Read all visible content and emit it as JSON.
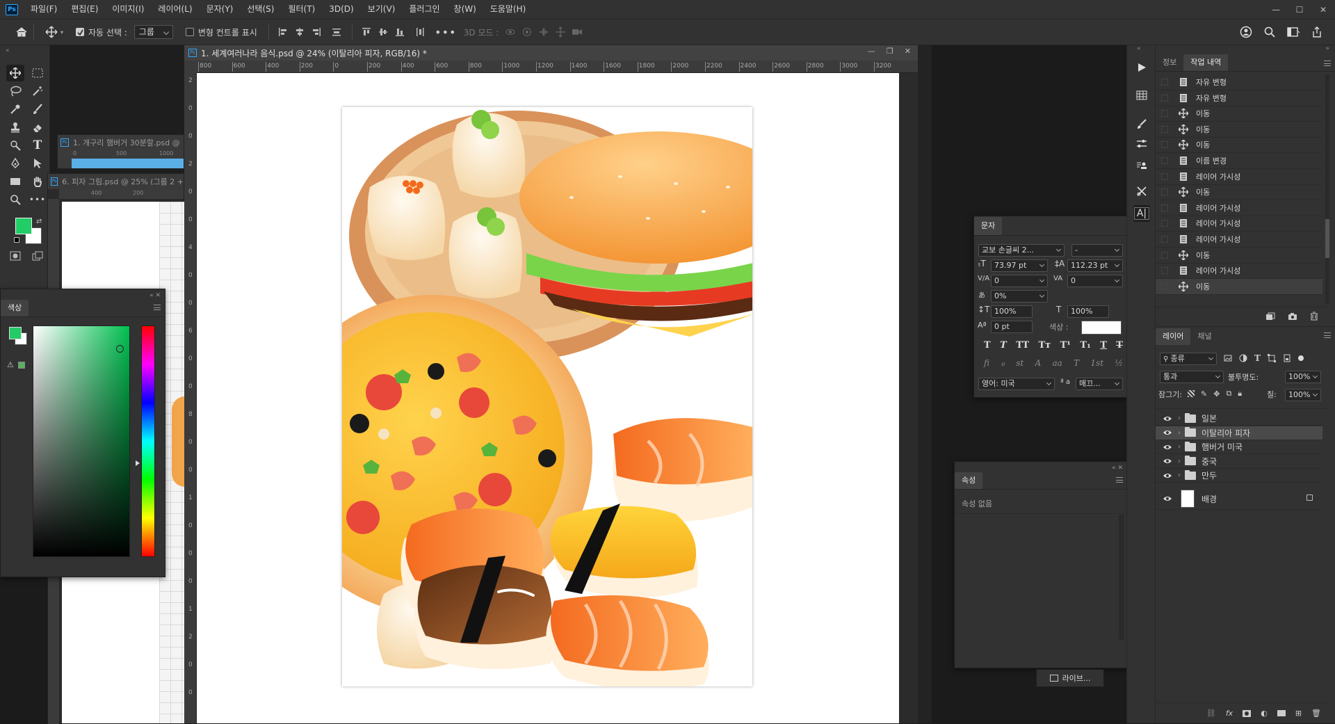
{
  "app": {
    "logo": "Ps"
  },
  "menu": [
    "파일(F)",
    "편집(E)",
    "이미지(I)",
    "레이어(L)",
    "문자(Y)",
    "선택(S)",
    "필터(T)",
    "3D(D)",
    "보기(V)",
    "플러그인",
    "창(W)",
    "도움말(H)"
  ],
  "options": {
    "auto_select_label": "자동 선택 :",
    "auto_select_value": "그룹",
    "transform_controls_label": "변형 컨트롤 표시",
    "mode3d_label": "3D 모드 :"
  },
  "document": {
    "tab_title": "1. 세계여러나라 음식.psd @ 24% (이탈리아 피자, RGB/16) *",
    "ruler_h": [
      "800",
      "600",
      "400",
      "200",
      "0",
      "200",
      "400",
      "600",
      "800",
      "1000",
      "1200",
      "1400",
      "1600",
      "1800",
      "2000",
      "2200",
      "2400",
      "2600",
      "2800",
      "3000",
      "3200"
    ],
    "ruler_v": [
      "2",
      "0",
      "0",
      "2",
      "0",
      "0",
      "4",
      "0",
      "0",
      "6",
      "0",
      "0",
      "8",
      "0",
      "0",
      "1",
      "0",
      "0",
      "0",
      "1",
      "2",
      "0",
      "0"
    ]
  },
  "bg_docs": [
    {
      "title": "1. 개구리 햄버거 30분할.psd @",
      "ruler": [
        "0",
        "500",
        "1000"
      ]
    },
    {
      "title": "6. 피자 그림.psd @ 25% (그룹 2 +",
      "ruler": [
        "400",
        "200"
      ]
    }
  ],
  "color_panel": {
    "title": "색상",
    "fg": "#22cc66",
    "bg": "#ffffff",
    "hue_color": "#00c050"
  },
  "history": {
    "tabs": [
      "정보",
      "작업 내역"
    ],
    "items": [
      {
        "icon": "doc",
        "label": "자유 변형"
      },
      {
        "icon": "doc",
        "label": "자유 변형"
      },
      {
        "icon": "move",
        "label": "이동"
      },
      {
        "icon": "move",
        "label": "이동"
      },
      {
        "icon": "move",
        "label": "이동"
      },
      {
        "icon": "doc",
        "label": "이름 변경"
      },
      {
        "icon": "doc",
        "label": "레이어 가시성"
      },
      {
        "icon": "move",
        "label": "이동"
      },
      {
        "icon": "doc",
        "label": "레이어 가시성"
      },
      {
        "icon": "doc",
        "label": "레이어 가시성"
      },
      {
        "icon": "doc",
        "label": "레이어 가시성"
      },
      {
        "icon": "move",
        "label": "이동"
      },
      {
        "icon": "doc",
        "label": "레이어 가시성"
      },
      {
        "icon": "move",
        "label": "이동"
      }
    ]
  },
  "layers": {
    "tabs": [
      "레이어",
      "채널"
    ],
    "filter_label": "종류",
    "blend_mode": "통과",
    "opacity_label": "불투명도:",
    "opacity_value": "100%",
    "lock_label": "잠그기:",
    "fill_label": "칠:",
    "fill_value": "100%",
    "items": [
      {
        "name": "일본",
        "type": "folder",
        "selected": false
      },
      {
        "name": "이탈리아 피자",
        "type": "folder",
        "selected": true
      },
      {
        "name": "햄버거 미국",
        "type": "folder",
        "selected": false
      },
      {
        "name": "중국",
        "type": "folder",
        "selected": false
      },
      {
        "name": "만두",
        "type": "folder",
        "selected": false
      },
      {
        "name": "배경",
        "type": "background",
        "selected": false
      }
    ]
  },
  "character": {
    "title": "문자",
    "font_family": "교보 손글씨 2...",
    "font_style": "-",
    "font_size": "73.97 pt",
    "leading": "112.23 pt",
    "kerning": "0",
    "tracking": "0",
    "tsume": "0%",
    "vscale": "100%",
    "hscale": "100%",
    "baseline": "0 pt",
    "color_label": "색상 :",
    "style_buttons": [
      "T",
      "T",
      "TT",
      "Tт",
      "T¹",
      "T₁",
      "T",
      "T"
    ],
    "ot_buttons": [
      "fi",
      "ℴ",
      "st",
      "A",
      "aa",
      "T",
      "1st",
      "½"
    ],
    "language": "영어: 미국",
    "aa_label": "ª a",
    "aa_value": "매끄..."
  },
  "properties": {
    "title": "속성",
    "empty_label": "속성 없음"
  },
  "live_chip": {
    "label": "라이브..."
  }
}
